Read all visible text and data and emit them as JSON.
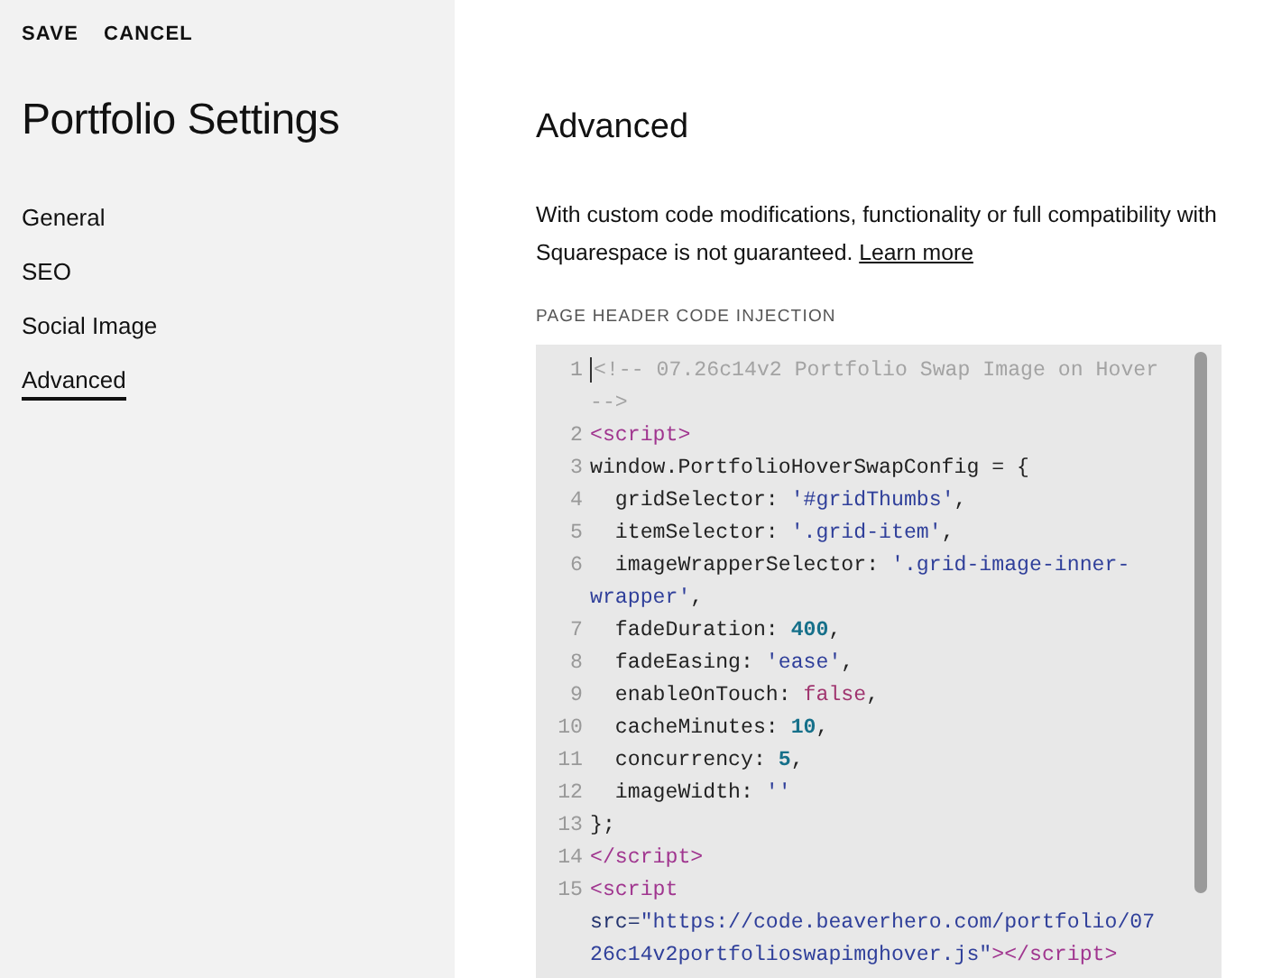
{
  "actions": [
    {
      "label": "SAVE"
    },
    {
      "label": "CANCEL"
    }
  ],
  "sidebar": {
    "title": "Portfolio Settings",
    "items": [
      {
        "label": "General",
        "selected": false
      },
      {
        "label": "SEO",
        "selected": false
      },
      {
        "label": "Social Image",
        "selected": false
      },
      {
        "label": "Advanced",
        "selected": true
      }
    ]
  },
  "main": {
    "title": "Advanced",
    "description": "With custom code modifications, functionality or full compatibility with Squarespace is not guaranteed.",
    "link": "Learn more",
    "section_label": "PAGE HEADER CODE INJECTION",
    "code_lines": [
      {
        "number": "1",
        "segments": [
          {
            "kind": "comment",
            "text": "<!-- 07.26c14v2 Portfolio Swap Image on Hover -->"
          }
        ]
      },
      {
        "number": "2",
        "segments": [
          {
            "kind": "tag",
            "text": "<script>"
          }
        ]
      },
      {
        "number": "3",
        "segments": [
          {
            "kind": "plain",
            "text": "window.PortfolioHoverSwapConfig = {"
          }
        ]
      },
      {
        "number": "4",
        "segments": [
          {
            "kind": "plain",
            "text": "  gridSelector: "
          },
          {
            "kind": "string",
            "text": "'#gridThumbs'"
          },
          {
            "kind": "plain",
            "text": ","
          }
        ]
      },
      {
        "number": "5",
        "segments": [
          {
            "kind": "plain",
            "text": "  itemSelector: "
          },
          {
            "kind": "string",
            "text": "'.grid-item'"
          },
          {
            "kind": "plain",
            "text": ","
          }
        ]
      },
      {
        "number": "6",
        "segments": [
          {
            "kind": "plain",
            "text": "  imageWrapperSelector: "
          },
          {
            "kind": "string",
            "text": "'.grid-image-inner-wrapper'"
          },
          {
            "kind": "plain",
            "text": ","
          }
        ]
      },
      {
        "number": "7",
        "segments": [
          {
            "kind": "plain",
            "text": "  fadeDuration: "
          },
          {
            "kind": "number",
            "text": "400"
          },
          {
            "kind": "plain",
            "text": ","
          }
        ]
      },
      {
        "number": "8",
        "segments": [
          {
            "kind": "plain",
            "text": "  fadeEasing: "
          },
          {
            "kind": "string",
            "text": "'ease'"
          },
          {
            "kind": "plain",
            "text": ","
          }
        ]
      },
      {
        "number": "9",
        "segments": [
          {
            "kind": "plain",
            "text": "  enableOnTouch: "
          },
          {
            "kind": "atom",
            "text": "false"
          },
          {
            "kind": "plain",
            "text": ","
          }
        ]
      },
      {
        "number": "10",
        "segments": [
          {
            "kind": "plain",
            "text": "  cacheMinutes: "
          },
          {
            "kind": "number",
            "text": "10"
          },
          {
            "kind": "plain",
            "text": ","
          }
        ]
      },
      {
        "number": "11",
        "segments": [
          {
            "kind": "plain",
            "text": "  concurrency: "
          },
          {
            "kind": "number",
            "text": "5"
          },
          {
            "kind": "plain",
            "text": ","
          }
        ]
      },
      {
        "number": "12",
        "segments": [
          {
            "kind": "plain",
            "text": "  imageWidth: "
          },
          {
            "kind": "string",
            "text": "''"
          }
        ]
      },
      {
        "number": "13",
        "segments": [
          {
            "kind": "plain",
            "text": "};"
          }
        ]
      },
      {
        "number": "14",
        "segments": [
          {
            "kind": "tag",
            "text": "</script>"
          }
        ]
      },
      {
        "number": "15",
        "segments": [
          {
            "kind": "tag",
            "text": "<script"
          },
          {
            "kind": "attr",
            "text": " src="
          },
          {
            "kind": "string",
            "text": "\"https://code.beaverhero.com/portfolio/0726c14v2portfolioswapimghover.js\""
          },
          {
            "kind": "tag",
            "text": "></script>"
          }
        ]
      }
    ]
  }
}
